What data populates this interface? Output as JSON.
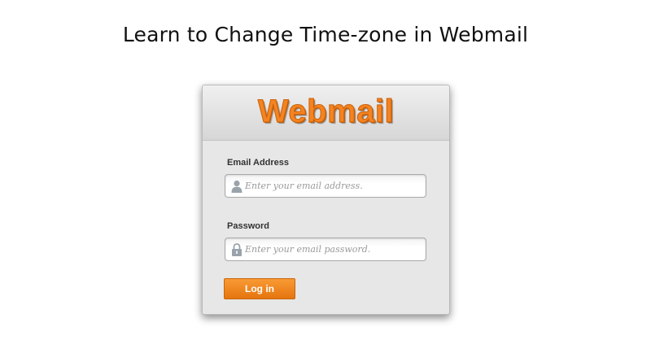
{
  "page": {
    "headline": "Learn to Change Time-zone in Webmail"
  },
  "login": {
    "brand": "Webmail",
    "email": {
      "label": "Email Address",
      "placeholder": "Enter your email address.",
      "icon": "user-icon"
    },
    "password": {
      "label": "Password",
      "placeholder": "Enter your email password.",
      "icon": "lock-icon"
    },
    "submit_label": "Log in"
  },
  "colors": {
    "brand_orange": "#f5831f",
    "button_orange": "#ef8420",
    "card_background": "#e7e7e7"
  }
}
